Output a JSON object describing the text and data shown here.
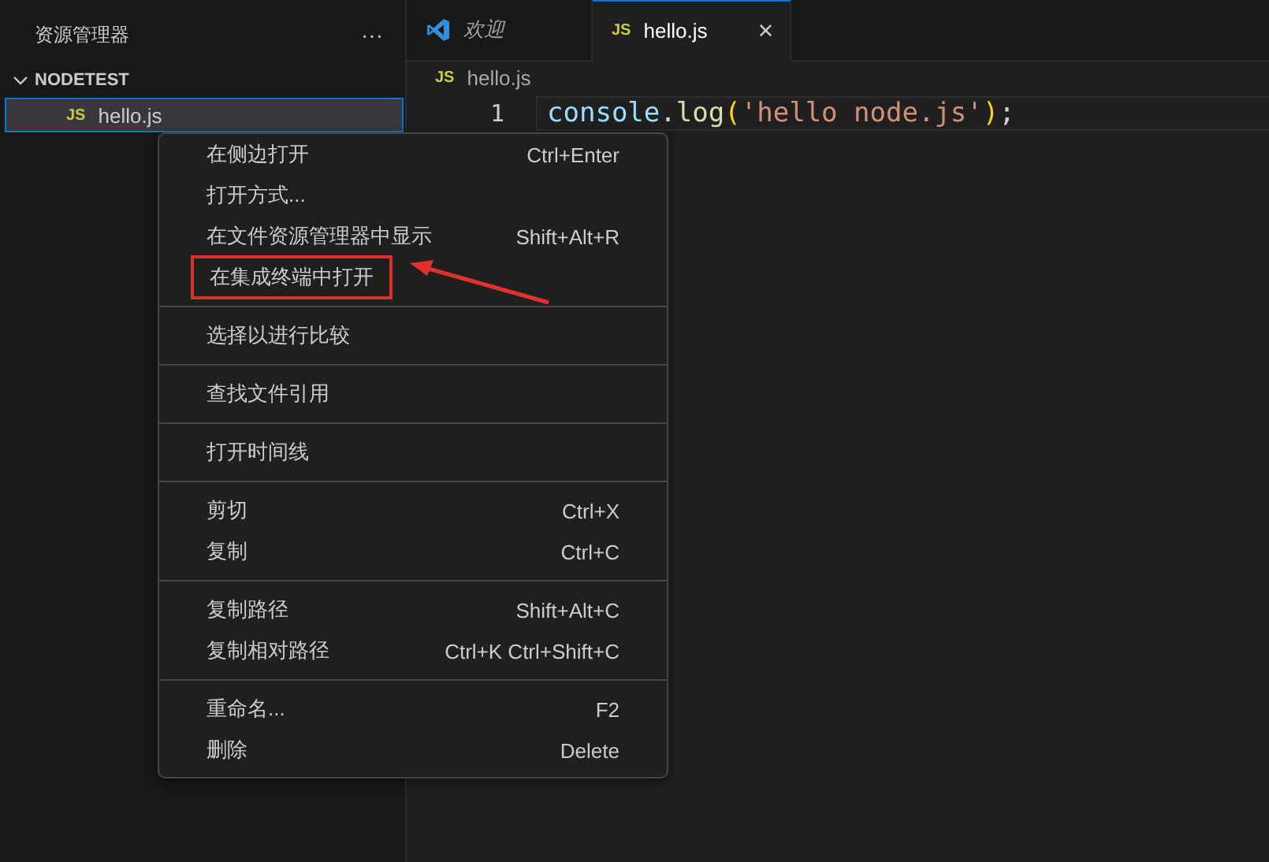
{
  "sidebar": {
    "title": "资源管理器",
    "more": "···",
    "folder": {
      "name": "NODETEST",
      "expanded": true,
      "files": [
        {
          "name": "hello.js",
          "badge": "JS",
          "selected": true
        }
      ]
    }
  },
  "tabs": [
    {
      "label": "欢迎",
      "kind": "welcome",
      "selected": false
    },
    {
      "label": "hello.js",
      "kind": "js",
      "badge": "JS",
      "close": "×",
      "selected": true
    }
  ],
  "breadcrumb": {
    "badge": "JS",
    "label": "hello.js"
  },
  "editor": {
    "lines": [
      {
        "number": "1",
        "tokens": [
          {
            "text": "console",
            "kind": "var"
          },
          {
            "text": ".",
            "kind": "plain"
          },
          {
            "text": "log",
            "kind": "func"
          },
          {
            "text": "(",
            "kind": "paren"
          },
          {
            "text": "'hello node.js'",
            "kind": "string"
          },
          {
            "text": ")",
            "kind": "paren"
          },
          {
            "text": ";",
            "kind": "plain"
          }
        ]
      }
    ]
  },
  "context_menu": {
    "groups": [
      [
        {
          "label": "在侧边打开",
          "shortcut": "Ctrl+Enter",
          "annotated": false
        },
        {
          "label": "打开方式...",
          "annotated": false
        },
        {
          "label": "在文件资源管理器中显示",
          "shortcut": "Shift+Alt+R",
          "annotated": false
        },
        {
          "label": "在集成终端中打开",
          "annotated": true
        }
      ],
      [
        {
          "label": "选择以进行比较",
          "annotated": false
        }
      ],
      [
        {
          "label": "查找文件引用",
          "annotated": false
        }
      ],
      [
        {
          "label": "打开时间线",
          "annotated": false
        }
      ],
      [
        {
          "label": "剪切",
          "shortcut": "Ctrl+X",
          "annotated": false
        },
        {
          "label": "复制",
          "shortcut": "Ctrl+C",
          "annotated": false
        }
      ],
      [
        {
          "label": "复制路径",
          "shortcut": "Shift+Alt+C",
          "annotated": false
        },
        {
          "label": "复制相对路径",
          "shortcut": "Ctrl+K Ctrl+Shift+C",
          "annotated": false
        }
      ],
      [
        {
          "label": "重命名...",
          "shortcut": "F2",
          "annotated": false
        },
        {
          "label": "删除",
          "shortcut": "Delete",
          "annotated": false
        }
      ]
    ]
  }
}
